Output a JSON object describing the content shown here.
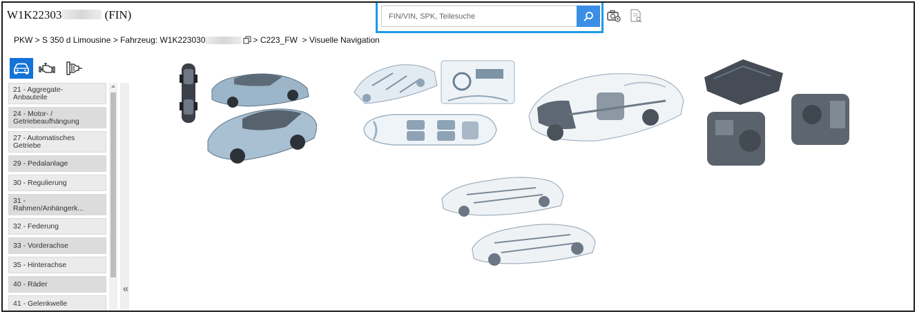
{
  "header": {
    "vin_prefix": "W1K22303",
    "vin_suffix": "(FIN)"
  },
  "search": {
    "placeholder": "FIN/VIN, SPK, Teilesuche",
    "value": ""
  },
  "toolbar": {
    "camera_icon": "camera-settings-icon",
    "report_icon": "document-search-icon"
  },
  "breadcrumb": {
    "part1": "PKW > S 350 d Limousine > Fahrzeug: W1K223030",
    "part2": "> C223_FW  > Visuelle Navigation"
  },
  "category_tabs": [
    {
      "icon": "car-icon",
      "active": true
    },
    {
      "icon": "engine-icon",
      "active": false
    },
    {
      "icon": "transmission-icon",
      "active": false
    }
  ],
  "nav": {
    "items": [
      {
        "label": "21 - Aggregate-\nAnbauteile"
      },
      {
        "label": "24 - Motor- /\nGetriebeaufhängung"
      },
      {
        "label": "27 - Automatisches\nGetriebe"
      },
      {
        "label": "29 - Pedalanlage"
      },
      {
        "label": "30 - Regulierung"
      },
      {
        "label": "31 -\nRahmen/Anhängerk..."
      },
      {
        "label": "32 - Federung"
      },
      {
        "label": "33 - Vorderachse"
      },
      {
        "label": "35 - Hinterachse"
      },
      {
        "label": "40 - Räder"
      },
      {
        "label": "41 - Gelenkwelle"
      }
    ],
    "collapse_label": "«"
  },
  "colors": {
    "accent": "#1e9be6",
    "active_tab": "#1473d6",
    "search_button": "#3a8ee6"
  }
}
